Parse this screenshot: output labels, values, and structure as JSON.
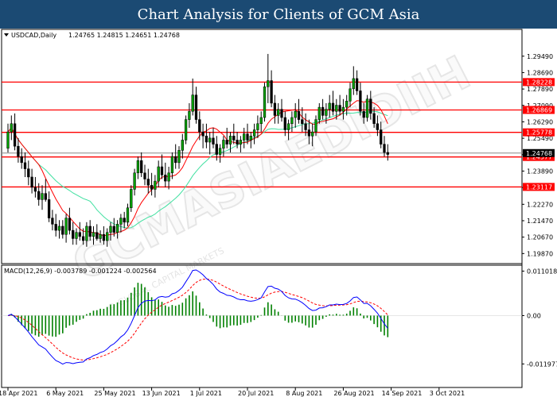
{
  "header": {
    "title": "Chart Analysis for Clients of GCM Asia"
  },
  "watermark": {
    "main_text": "GCMASIAEDIDIIH",
    "sub_text": "© GLOBAL CAPITAL MARKETS"
  },
  "colors": {
    "bull": "#00a000",
    "bear": "#000000",
    "support": "#ff0000",
    "ma_fast": "#ff0000",
    "ma_slow": "#40e0a0",
    "macd": "#0000ff",
    "signal": "#ff0000",
    "hist": "#008000",
    "header_bg": "#1b4a73"
  },
  "chart_data": [
    {
      "type": "candlestick",
      "info": {
        "symbol": "USDCAD,Daily",
        "ohlc": "1.24765 1.24815 1.24651 1.24768"
      },
      "ylim": [
        1.1965,
        1.301
      ],
      "y_ticks": [
        "1.29490",
        "1.28690",
        "1.27890",
        "1.27090",
        "1.26290",
        "1.25490",
        "1.24690",
        "1.23890",
        "1.23090",
        "1.22270",
        "1.21470",
        "1.20670",
        "1.19870"
      ],
      "levels": [
        {
          "value": 1.28228,
          "label": "1.28228"
        },
        {
          "value": 1.26869,
          "label": "1.26869"
        },
        {
          "value": 1.25778,
          "label": "1.25778"
        },
        {
          "value": 1.24577,
          "label": "1.24577"
        },
        {
          "value": 1.23117,
          "label": "1.23117"
        }
      ],
      "current_price": {
        "value": 1.24768,
        "label": "1.24768"
      },
      "x_ticks": [
        "18 Apr 2021",
        "6 May 2021",
        "25 May 2021",
        "13 Jun 2021",
        "1 Jul 2021",
        "20 Jul 2021",
        "8 Aug 2021",
        "26 Aug 2021",
        "14 Sep 2021",
        "3 Oct 2021"
      ],
      "x_tick_index": [
        0,
        14,
        28,
        42,
        56,
        70,
        84,
        98,
        112,
        126
      ],
      "ohlc": [
        [
          1.25,
          1.262,
          1.248,
          1.258
        ],
        [
          1.258,
          1.266,
          1.254,
          1.262
        ],
        [
          1.262,
          1.267,
          1.249,
          1.251
        ],
        [
          1.251,
          1.255,
          1.243,
          1.246
        ],
        [
          1.246,
          1.25,
          1.24,
          1.243
        ],
        [
          1.243,
          1.248,
          1.236,
          1.24
        ],
        [
          1.24,
          1.244,
          1.232,
          1.236
        ],
        [
          1.236,
          1.24,
          1.228,
          1.231
        ],
        [
          1.231,
          1.236,
          1.226,
          1.229
        ],
        [
          1.229,
          1.233,
          1.222,
          1.225
        ],
        [
          1.225,
          1.232,
          1.22,
          1.228
        ],
        [
          1.228,
          1.235,
          1.224,
          1.225
        ],
        [
          1.225,
          1.229,
          1.214,
          1.216
        ],
        [
          1.216,
          1.22,
          1.21,
          1.213
        ],
        [
          1.213,
          1.218,
          1.207,
          1.21
        ],
        [
          1.21,
          1.215,
          1.206,
          1.212
        ],
        [
          1.212,
          1.215,
          1.206,
          1.208
        ],
        [
          1.208,
          1.218,
          1.204,
          1.216
        ],
        [
          1.216,
          1.221,
          1.208,
          1.21
        ],
        [
          1.21,
          1.214,
          1.203,
          1.206
        ],
        [
          1.206,
          1.211,
          1.203,
          1.209
        ],
        [
          1.209,
          1.214,
          1.205,
          1.207
        ],
        [
          1.207,
          1.211,
          1.203,
          1.205
        ],
        [
          1.205,
          1.214,
          1.202,
          1.212
        ],
        [
          1.212,
          1.215,
          1.205,
          1.207
        ],
        [
          1.207,
          1.212,
          1.203,
          1.209
        ],
        [
          1.209,
          1.213,
          1.205,
          1.206
        ],
        [
          1.206,
          1.21,
          1.204,
          1.208
        ],
        [
          1.208,
          1.212,
          1.203,
          1.205
        ],
        [
          1.205,
          1.211,
          1.202,
          1.209
        ],
        [
          1.209,
          1.214,
          1.205,
          1.212
        ],
        [
          1.212,
          1.216,
          1.207,
          1.209
        ],
        [
          1.209,
          1.215,
          1.206,
          1.213
        ],
        [
          1.213,
          1.218,
          1.209,
          1.216
        ],
        [
          1.216,
          1.219,
          1.211,
          1.214
        ],
        [
          1.214,
          1.223,
          1.212,
          1.221
        ],
        [
          1.221,
          1.232,
          1.219,
          1.23
        ],
        [
          1.23,
          1.24,
          1.227,
          1.238
        ],
        [
          1.238,
          1.246,
          1.235,
          1.244
        ],
        [
          1.244,
          1.248,
          1.236,
          1.238
        ],
        [
          1.238,
          1.242,
          1.232,
          1.235
        ],
        [
          1.235,
          1.24,
          1.228,
          1.232
        ],
        [
          1.232,
          1.238,
          1.227,
          1.23
        ],
        [
          1.23,
          1.237,
          1.226,
          1.234
        ],
        [
          1.234,
          1.244,
          1.231,
          1.241
        ],
        [
          1.241,
          1.247,
          1.235,
          1.237
        ],
        [
          1.237,
          1.243,
          1.231,
          1.234
        ],
        [
          1.234,
          1.241,
          1.23,
          1.238
        ],
        [
          1.238,
          1.248,
          1.235,
          1.246
        ],
        [
          1.246,
          1.252,
          1.24,
          1.243
        ],
        [
          1.243,
          1.251,
          1.24,
          1.249
        ],
        [
          1.249,
          1.257,
          1.245,
          1.254
        ],
        [
          1.254,
          1.266,
          1.252,
          1.264
        ],
        [
          1.264,
          1.272,
          1.26,
          1.268
        ],
        [
          1.268,
          1.284,
          1.266,
          1.276
        ],
        [
          1.276,
          1.28,
          1.262,
          1.264
        ],
        [
          1.264,
          1.268,
          1.254,
          1.258
        ],
        [
          1.258,
          1.262,
          1.25,
          1.256
        ],
        [
          1.256,
          1.262,
          1.25,
          1.253
        ],
        [
          1.253,
          1.258,
          1.247,
          1.255
        ],
        [
          1.255,
          1.26,
          1.25,
          1.252
        ],
        [
          1.252,
          1.256,
          1.244,
          1.247
        ],
        [
          1.247,
          1.252,
          1.243,
          1.25
        ],
        [
          1.25,
          1.256,
          1.246,
          1.254
        ],
        [
          1.254,
          1.26,
          1.25,
          1.252
        ],
        [
          1.252,
          1.258,
          1.248,
          1.256
        ],
        [
          1.256,
          1.262,
          1.252,
          1.254
        ],
        [
          1.254,
          1.258,
          1.25,
          1.252
        ],
        [
          1.252,
          1.256,
          1.248,
          1.254
        ],
        [
          1.254,
          1.26,
          1.25,
          1.257
        ],
        [
          1.257,
          1.262,
          1.252,
          1.254
        ],
        [
          1.254,
          1.258,
          1.25,
          1.256
        ],
        [
          1.256,
          1.262,
          1.252,
          1.259
        ],
        [
          1.259,
          1.266,
          1.255,
          1.262
        ],
        [
          1.262,
          1.268,
          1.258,
          1.265
        ],
        [
          1.265,
          1.282,
          1.263,
          1.28
        ],
        [
          1.28,
          1.296,
          1.272,
          1.283
        ],
        [
          1.283,
          1.288,
          1.27,
          1.272
        ],
        [
          1.272,
          1.276,
          1.262,
          1.266
        ],
        [
          1.266,
          1.272,
          1.262,
          1.269
        ],
        [
          1.269,
          1.274,
          1.263,
          1.265
        ],
        [
          1.265,
          1.268,
          1.256,
          1.259
        ],
        [
          1.259,
          1.264,
          1.254,
          1.262
        ],
        [
          1.262,
          1.268,
          1.258,
          1.265
        ],
        [
          1.265,
          1.272,
          1.26,
          1.268
        ],
        [
          1.268,
          1.274,
          1.262,
          1.264
        ],
        [
          1.264,
          1.27,
          1.258,
          1.262
        ],
        [
          1.262,
          1.267,
          1.256,
          1.259
        ],
        [
          1.259,
          1.264,
          1.252,
          1.256
        ],
        [
          1.256,
          1.262,
          1.251,
          1.258
        ],
        [
          1.258,
          1.266,
          1.256,
          1.264
        ],
        [
          1.264,
          1.272,
          1.262,
          1.27
        ],
        [
          1.27,
          1.274,
          1.264,
          1.266
        ],
        [
          1.266,
          1.272,
          1.262,
          1.269
        ],
        [
          1.269,
          1.276,
          1.265,
          1.272
        ],
        [
          1.272,
          1.278,
          1.266,
          1.268
        ],
        [
          1.268,
          1.274,
          1.264,
          1.271
        ],
        [
          1.271,
          1.276,
          1.266,
          1.268
        ],
        [
          1.268,
          1.274,
          1.264,
          1.27
        ],
        [
          1.27,
          1.276,
          1.266,
          1.273
        ],
        [
          1.273,
          1.282,
          1.27,
          1.279
        ],
        [
          1.279,
          1.29,
          1.276,
          1.284
        ],
        [
          1.284,
          1.288,
          1.276,
          1.278
        ],
        [
          1.278,
          1.282,
          1.266,
          1.268
        ],
        [
          1.268,
          1.272,
          1.262,
          1.265
        ],
        [
          1.265,
          1.276,
          1.263,
          1.274
        ],
        [
          1.274,
          1.278,
          1.264,
          1.267
        ],
        [
          1.267,
          1.27,
          1.26,
          1.262
        ],
        [
          1.262,
          1.266,
          1.256,
          1.259
        ],
        [
          1.259,
          1.263,
          1.25,
          1.252
        ],
        [
          1.252,
          1.256,
          1.246,
          1.248
        ],
        [
          1.248,
          1.252,
          1.244,
          1.247
        ]
      ],
      "macd": {
        "info": "MACD(12,26,9) -0.003789 -0.001224 -0.002564",
        "ylim": [
          -0.0123,
          0.0113
        ],
        "y_ticks": [
          {
            "value": 0.011018,
            "label": "0.011018"
          },
          {
            "value": 0.0,
            "label": "0.00"
          },
          {
            "value": -0.011977,
            "label": "-0.011977"
          }
        ]
      }
    }
  ]
}
